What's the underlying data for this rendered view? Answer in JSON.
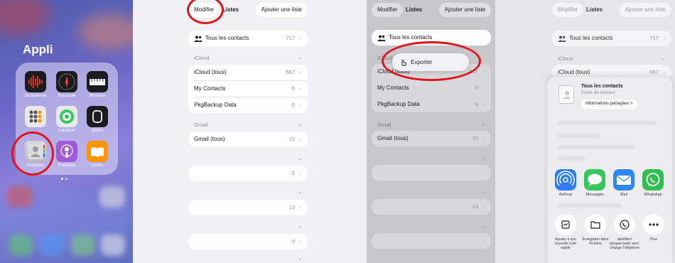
{
  "panel1": {
    "folder_title": "Appli",
    "apps": [
      {
        "name": "Dictaphone",
        "icon": "dictaphone-icon"
      },
      {
        "name": "Boussole",
        "icon": "compass-icon"
      },
      {
        "name": "Mesures",
        "icon": "measure-icon"
      },
      {
        "name": "",
        "icon": "calculator-icon"
      },
      {
        "name": "Localiser",
        "icon": "findmy-icon"
      },
      {
        "name": "Watch",
        "icon": "watch-icon"
      },
      {
        "name": "Contacts",
        "icon": "contacts-icon"
      },
      {
        "name": "Podcasts",
        "icon": "podcasts-icon"
      },
      {
        "name": "Livres",
        "icon": "books-icon"
      }
    ]
  },
  "list": {
    "toolbar": {
      "edit_label": "Modifier",
      "lists_label": "Listes",
      "add_list_label": "Ajouter une liste"
    },
    "all_contacts": {
      "label": "Tous les contacts",
      "count": "717"
    },
    "icloud": {
      "header": "iCloud",
      "rows": [
        {
          "label": "iCloud (tous)",
          "count": "567"
        },
        {
          "label": "My Contacts",
          "count": "0"
        },
        {
          "label": "PkgBackup Data",
          "count": "0"
        }
      ]
    },
    "gmail": {
      "header": "Gmail",
      "rows": [
        {
          "label": "Gmail (tous)",
          "count": "72"
        }
      ]
    },
    "extra_counts": [
      "",
      "0",
      "13",
      "9"
    ]
  },
  "context_menu": {
    "export_label": "Exporter"
  },
  "share_sheet": {
    "contact_title": "Tous les contacts",
    "contact_subtitle": "Fiche de contact",
    "shared_info_label": "Informations partagées >",
    "apps": [
      {
        "label": "AirDrop",
        "icon": "airdrop-icon",
        "color": "#2f7cf6"
      },
      {
        "label": "Messages",
        "icon": "messages-icon",
        "color": "#34c759"
      },
      {
        "label": "Mail",
        "icon": "mail-icon",
        "color": "#2f88f0"
      },
      {
        "label": "WhatsApp",
        "icon": "whatsapp-icon",
        "color": "#2fbe4f"
      }
    ],
    "actions": [
      {
        "label": "Ajouter à une nouvelle note rapide",
        "icon": "quick-note-icon"
      },
      {
        "label": "Enregistrer dans Fichiers",
        "icon": "folder-icon"
      },
      {
        "label": "Identifier/ bloquer/noter avec Orange Téléphone",
        "icon": "phone-icon"
      },
      {
        "label": "Plus",
        "icon": "more-icon"
      }
    ]
  },
  "colors": {
    "annotation_red": "#e0151b",
    "ios_blue": "#007aff"
  }
}
